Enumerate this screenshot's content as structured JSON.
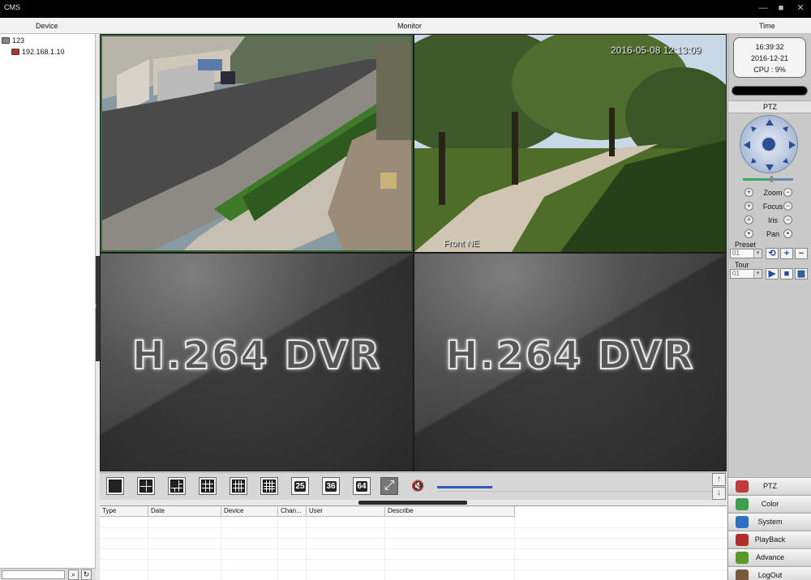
{
  "window": {
    "title": "CMS",
    "buttons": [
      "—",
      "■",
      "✕"
    ]
  },
  "header": {
    "device_label": "Device",
    "monitor_label": "Monitor",
    "time_label": "Time"
  },
  "device_tree": {
    "group_label": "123",
    "device_label": "192.168.1.10"
  },
  "video": {
    "channels": [
      {
        "type": "camera",
        "scene": "driveway",
        "selected": true
      },
      {
        "type": "camera",
        "scene": "park",
        "timestamp": "2016-05-08 12:13:09",
        "camera_name": "Front NE"
      },
      {
        "type": "idle",
        "logo": "H.264 DVR"
      },
      {
        "type": "idle",
        "logo": "H.264 DVR"
      }
    ]
  },
  "clock": {
    "time": "16:39:32",
    "date": "2016-12-21",
    "cpu": "CPU : 9%"
  },
  "ptz": {
    "title": "PTZ",
    "controls": [
      {
        "label": "Zoom",
        "minus": "−",
        "plus": "+"
      },
      {
        "label": "Focus",
        "minus": "−",
        "plus": "+"
      },
      {
        "label": "Iris",
        "minus": "−",
        "plus": "+"
      },
      {
        "label": "Pan",
        "minus": "•",
        "plus": "•"
      }
    ],
    "preset_label": "Preset",
    "preset_value": "01",
    "tour_label": "Tour",
    "tour_value": "01"
  },
  "menu": [
    {
      "label": "PTZ",
      "icon": "ptz-icon",
      "color": "#c23b3b"
    },
    {
      "label": "Color",
      "icon": "color-icon",
      "color": "#3ea04f"
    },
    {
      "label": "System",
      "icon": "system-icon",
      "color": "#2d6fc4"
    },
    {
      "label": "PlayBack",
      "icon": "playback-icon",
      "color": "#b02e2e"
    },
    {
      "label": "Advance",
      "icon": "advance-icon",
      "color": "#5a9a2a"
    },
    {
      "label": "LogOut",
      "icon": "logout-icon",
      "color": "#7a5a3a"
    }
  ],
  "toolbar": {
    "layouts": [
      "1",
      "4",
      "6",
      "9",
      "12",
      "16"
    ],
    "numeric_layouts": [
      "25",
      "36",
      "64"
    ],
    "volume_level": 0.2
  },
  "log_table": {
    "columns": [
      "Type",
      "Date",
      "Device",
      "Chan...",
      "User",
      "Describe"
    ]
  }
}
